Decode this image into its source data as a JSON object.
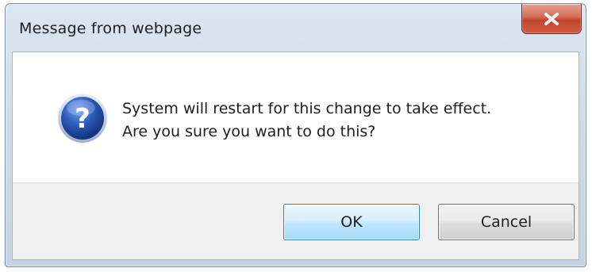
{
  "dialog": {
    "title": "Message from webpage",
    "close_icon": "close-icon",
    "icon": "question-icon",
    "icon_glyph": "?",
    "message_lines": [
      "System will restart for this change to take effect.",
      "Are you sure you want to do this?"
    ],
    "buttons": {
      "ok_label": "OK",
      "cancel_label": "Cancel"
    }
  },
  "colors": {
    "close_button": "#c94a32",
    "ok_border": "#3c7fb1",
    "question_icon": "#2a57b8"
  }
}
